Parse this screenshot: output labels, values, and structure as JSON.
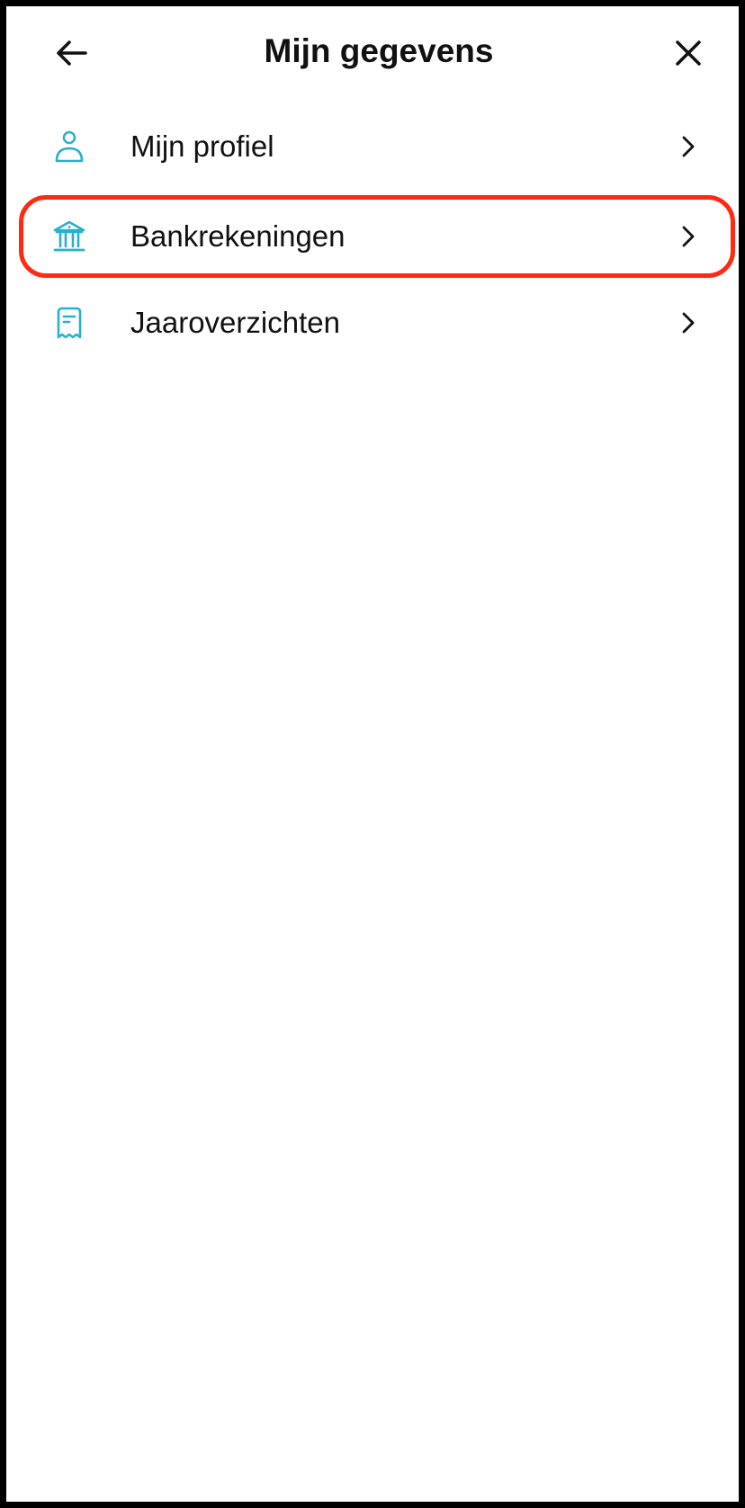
{
  "header": {
    "title": "Mijn gegevens",
    "back_icon": "arrow-left-icon",
    "close_icon": "close-icon"
  },
  "menu": {
    "items": [
      {
        "label": "Mijn profiel",
        "icon": "person-icon",
        "highlighted": false
      },
      {
        "label": "Bankrekeningen",
        "icon": "bank-icon",
        "highlighted": true
      },
      {
        "label": "Jaaroverzichten",
        "icon": "receipt-icon",
        "highlighted": false
      }
    ]
  },
  "colors": {
    "icon_accent": "#2ab0cf",
    "highlight": "#ff2a12",
    "text": "#111111",
    "frame": "#000000"
  }
}
